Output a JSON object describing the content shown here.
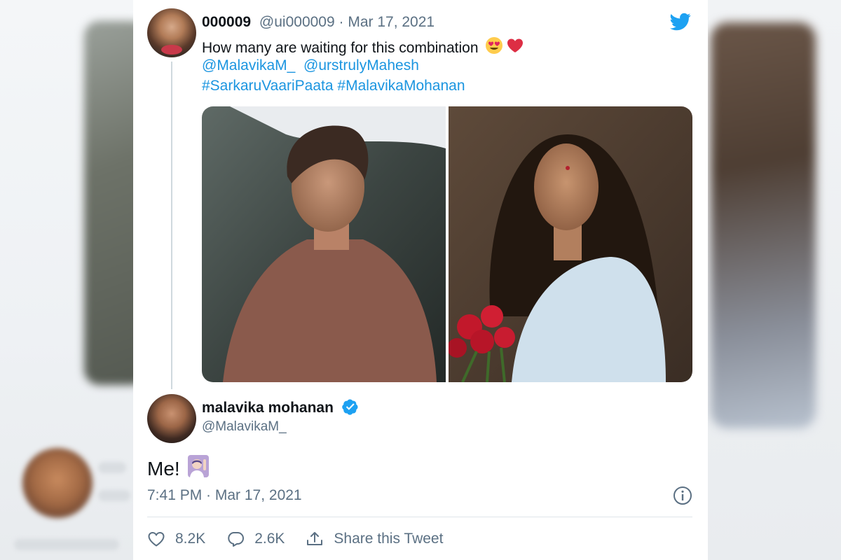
{
  "original_tweet": {
    "display_name": "000009",
    "handle": "@ui000009",
    "date": "· Mar 17, 2021",
    "text": "How many are waiting for this combination",
    "mentions": [
      "@MalavikaM_",
      "@urstrulyMahesh"
    ],
    "hashtags": [
      "#SarkaruVaariPaata",
      "#MalavikaMohanan"
    ]
  },
  "reply_tweet": {
    "display_name": "malavika mohanan",
    "handle": "@MalavikaM_",
    "text": "Me!",
    "time": "7:41 PM · Mar 17, 2021",
    "likes": "8.2K",
    "replies": "2.6K",
    "share_label": "Share this Tweet"
  },
  "icons": [
    "twitter-bird-icon",
    "heart-eyes-emoji",
    "red-heart-emoji",
    "verified-badge-icon",
    "raising-hand-emoji",
    "info-icon",
    "heart-icon",
    "reply-icon",
    "share-icon"
  ],
  "colors": {
    "link": "#1b95e0",
    "text": "#0f1419",
    "secondary": "#5b7083",
    "brand": "#1da1f2"
  }
}
